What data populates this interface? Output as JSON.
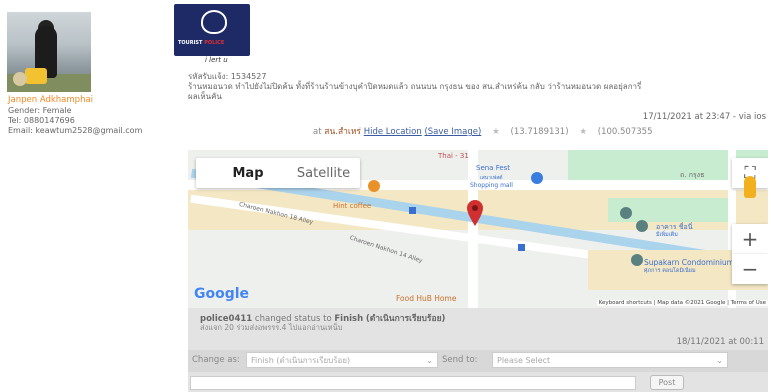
{
  "profile": {
    "name": "Janpen Adkhamphai",
    "gender": "Gender: Female",
    "tel": "Tel: 0880147696",
    "email": "Email: keawtum2528@gmail.com"
  },
  "logo": {
    "text_main": "TOURIST",
    "text_accent": "POLICE",
    "subtitle": "i lert u"
  },
  "case": {
    "id_line": "รหัสรับแจ้ง: 1534527",
    "desc_line1": "ร้านหมอนวด ทำไปยังไม่ปิดค้น ทั้งที่ร้านร้านข้างบุคำปิดหมดแล้ว ถนนบน กรุงธน ของ สน.สำเหร่ค้น กลับ ว่าร้านหมอนวด ผลอยุ่ลการี่",
    "desc_line2": "ผลเห็นคัน",
    "datetime": "17/11/2021 at 23:47 - via ios"
  },
  "location": {
    "prefix": "at",
    "place": "สน.สำเหร่",
    "hide_label": "Hide Location",
    "save_label": "(Save Image)",
    "coord1": "(13.7189131)",
    "coord2": "(100.507355"
  },
  "map": {
    "type_map": "Map",
    "type_satellite": "Satellite",
    "zoom_in": "+",
    "zoom_out": "−",
    "google": "Google",
    "attribution": "Keyboard shortcuts  |  Map data ©2021 Google  |  Terms of Use",
    "labels": {
      "thai_road": "Thai - 31",
      "sena_fest": "Sena Fest",
      "sena_fest_sub": "เสนาเฟสต์",
      "shopping_mall": "Shopping mall",
      "hint_coffee": "Hint coffee",
      "road1": "Charoen Nakhon 18 Alley",
      "road2": "Charoen Nakhon 14 Alley",
      "supakarn": "Supakarn Condominium",
      "supakarn_sub": "ศุภการ คอนโดมิเนียม",
      "food_hub": "Food HuB Home",
      "bldg": "อาคาร ชื่อนี่",
      "bldg2": "มีเพิ่มเติม",
      "top_right": "ถ. กรุงธ"
    }
  },
  "status": {
    "user": "police0411",
    "changed_text": "changed status to",
    "status_value": "Finish",
    "status_thai": "(ดำเนินการเรียบร้อย)",
    "note": "ส่งแจก 20 ร่วมส่งอพรรร.4 ไปแอกอ่านเหน็บ",
    "time": "18/11/2021 at 00:11"
  },
  "controls": {
    "change_label": "Change as:",
    "change_value": "Finish (ดำเนินการเรียบร้อย)",
    "send_label": "Send to:",
    "send_placeholder": "Please Select",
    "post_label": "Post"
  }
}
